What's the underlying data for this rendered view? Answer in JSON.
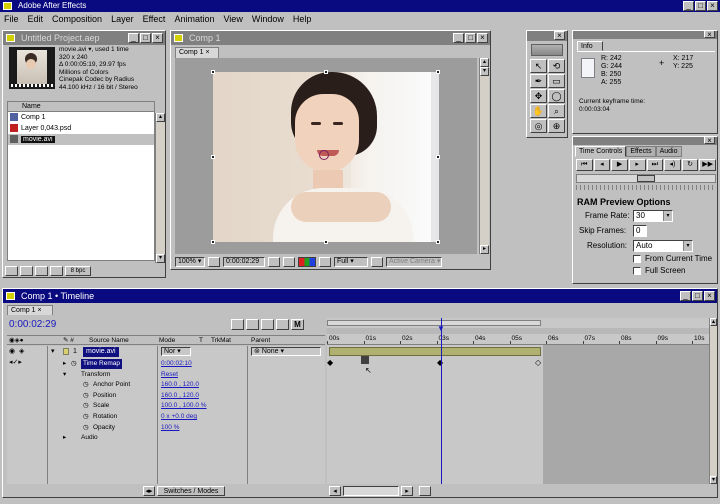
{
  "app": {
    "title": "Adobe After Effects"
  },
  "menu": [
    "File",
    "Edit",
    "Composition",
    "Layer",
    "Effect",
    "Animation",
    "View",
    "Window",
    "Help"
  ],
  "project": {
    "title": "Untitled Project.aep",
    "info_lines": [
      "movie.avi ▾, used 1 time",
      "320 x 240",
      "Δ 0:00:05:19, 29.97 fps",
      "Millions of Colors",
      "Cinepak Codec by Radius",
      "44.100 kHz / 16 bit / Stereo"
    ],
    "col_name": "Name",
    "items": [
      {
        "name": "Comp 1"
      },
      {
        "name": "Layer 0,043.psd"
      },
      {
        "name": "movie.avi"
      }
    ],
    "bpc": "8 bpc"
  },
  "comp": {
    "title": "Comp 1",
    "tab": "Comp 1",
    "zoom": "100%",
    "timecode": "0:00:02:29",
    "res": "Full",
    "view": "Active Camera"
  },
  "tools": {
    "title": ""
  },
  "info": {
    "tab": "Info",
    "r": "R: 242",
    "g": "G: 244",
    "b": "B: 250",
    "a": "A: 255",
    "x": "X: 217",
    "y": "Y: 225",
    "line1": "Current keyframe time:",
    "line2": "0:00:03:04"
  },
  "time_controls": {
    "tab": "Time Controls",
    "tab2": "Effects",
    "tab3": "Audio",
    "ram_title": "RAM Preview Options",
    "frame_rate_label": "Frame Rate:",
    "frame_rate": "30",
    "skip_label": "Skip Frames:",
    "skip": "0",
    "res_label": "Resolution:",
    "res": "Auto",
    "from_current": "From Current Time",
    "full_screen": "Full Screen"
  },
  "timeline": {
    "title": "Comp 1 • Timeline",
    "tab": "Comp 1",
    "timecode": "0:00:02:29",
    "cols": {
      "source": "Source Name",
      "mode": "Mode",
      "t": "T",
      "trkmat": "TrkMat",
      "parent": "Parent"
    },
    "layer": {
      "num": "1",
      "name": "movie.avi",
      "mode": "Nor",
      "parent": "None"
    },
    "props": [
      {
        "name": "Time Remap",
        "value": "0:00:02:10"
      },
      {
        "name": "Transform",
        "value": "Reset"
      },
      {
        "name": "Anchor Point",
        "value": "160.0 , 120.0"
      },
      {
        "name": "Position",
        "value": "160.0 , 120.0"
      },
      {
        "name": "Scale",
        "value": "100.0 , 100.0 %"
      },
      {
        "name": "Rotation",
        "value": "0 x +0.0 deg"
      },
      {
        "name": "Opacity",
        "value": "100 %"
      },
      {
        "name": "Audio",
        "value": ""
      }
    ],
    "ruler": [
      "00s",
      "01s",
      "02s",
      "03s",
      "04s",
      "05s",
      "06s",
      "07s",
      "08s",
      "09s",
      "10s"
    ],
    "switches": "Switches / Modes"
  }
}
